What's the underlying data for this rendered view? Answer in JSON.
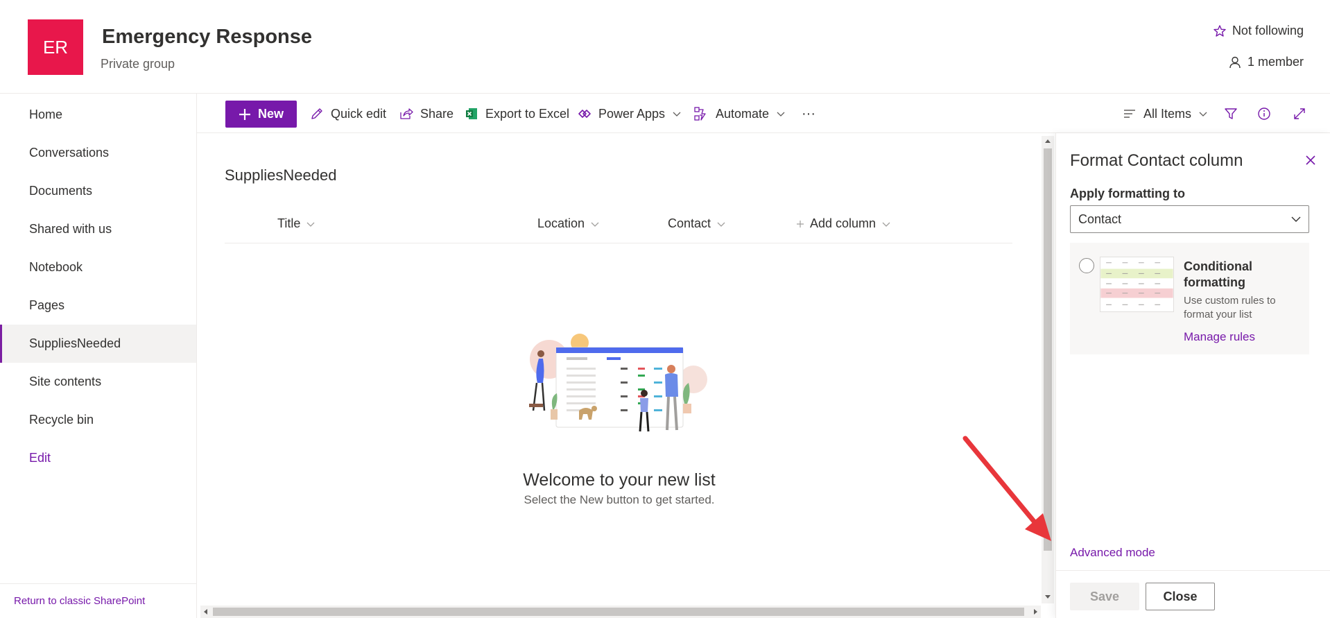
{
  "site": {
    "logo_text": "ER",
    "title": "Emergency Response",
    "subtitle": "Private group",
    "follow_label": "Not following",
    "members_label": "1 member",
    "accent_color": "#7719aa",
    "logo_color": "#e8174b"
  },
  "leftnav": {
    "items": [
      {
        "label": "Home"
      },
      {
        "label": "Conversations"
      },
      {
        "label": "Documents"
      },
      {
        "label": "Shared with us"
      },
      {
        "label": "Notebook"
      },
      {
        "label": "Pages"
      },
      {
        "label": "SuppliesNeeded",
        "active": true
      },
      {
        "label": "Site contents"
      },
      {
        "label": "Recycle bin"
      }
    ],
    "edit_label": "Edit",
    "return_label": "Return to classic SharePoint"
  },
  "commandbar": {
    "new_label": "New",
    "quick_edit_label": "Quick edit",
    "share_label": "Share",
    "export_label": "Export to Excel",
    "powerapps_label": "Power Apps",
    "automate_label": "Automate",
    "more_label": "···",
    "view_label": "All Items",
    "icons": [
      "plus-icon",
      "pencil-icon",
      "share-icon",
      "excel-icon",
      "power-apps-icon",
      "automate-icon",
      "more-icon",
      "list-view-icon",
      "filter-icon",
      "info-icon",
      "expand-icon"
    ]
  },
  "list": {
    "title": "SuppliesNeeded",
    "columns": [
      {
        "label": "Title"
      },
      {
        "label": "Location"
      },
      {
        "label": "Contact"
      }
    ],
    "add_column_label": "Add column",
    "empty_title": "Welcome to your new list",
    "empty_subtitle": "Select the New button to get started."
  },
  "panel": {
    "title": "Format Contact column",
    "apply_label": "Apply formatting to",
    "dropdown_value": "Contact",
    "card": {
      "title": "Conditional formatting",
      "description": "Use custom rules to format your list",
      "manage_label": "Manage rules"
    },
    "advanced_label": "Advanced mode",
    "save_label": "Save",
    "close_label": "Close"
  }
}
